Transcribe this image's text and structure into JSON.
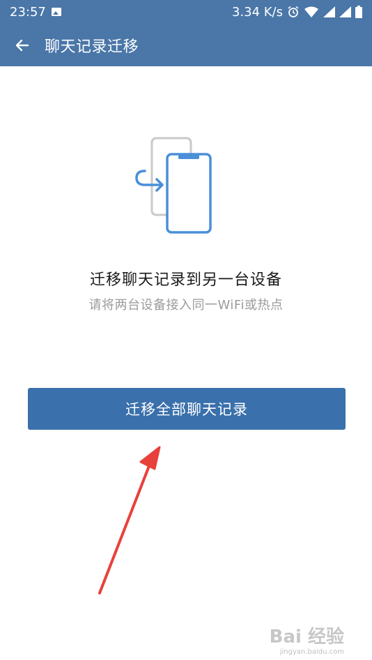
{
  "status_bar": {
    "time": "23:57",
    "speed": "3.34 K/s",
    "icons": [
      "image-icon",
      "alarm-icon",
      "wifi-icon",
      "signal-icon",
      "signal-icon",
      "battery-icon"
    ]
  },
  "app_bar": {
    "title": "聊天记录迁移",
    "back_icon": "back-arrow-icon"
  },
  "content": {
    "illustration_icon": "phone-transfer-icon",
    "title": "迁移聊天记录到另一台设备",
    "subtitle": "请将两台设备接入同一WiFi或热点",
    "button_label": "迁移全部聊天记录"
  },
  "annotation": {
    "arrow_color": "#e8413b"
  },
  "watermark": {
    "main": "Bai 经验",
    "sub": "jingyan.baidu.com"
  },
  "colors": {
    "header": "#4a76a8",
    "button": "#3a70ab",
    "illustration_blue": "#4a8fd8",
    "illustration_grey": "#c9c9c9"
  }
}
